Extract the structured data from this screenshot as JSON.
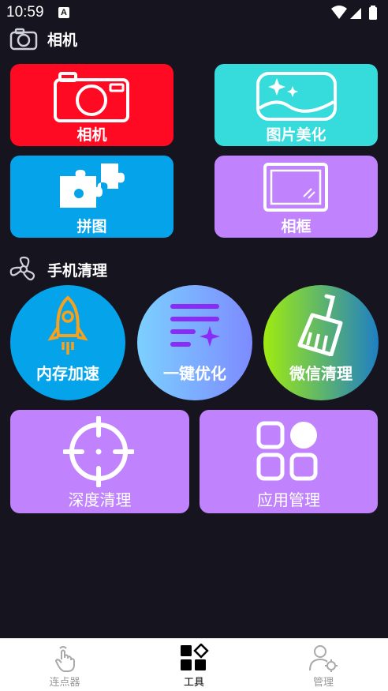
{
  "status": {
    "time": "10:59",
    "badge": "A"
  },
  "sections": {
    "camera": {
      "title": "相机"
    },
    "phone": {
      "title": "手机清理"
    }
  },
  "cards": {
    "camera": {
      "label": "相机",
      "color": "#ff0a22"
    },
    "beautify": {
      "label": "图片美化",
      "color": "#36dcdc"
    },
    "collage": {
      "label": "拼图",
      "color": "#05a3ea"
    },
    "frame": {
      "label": "相框",
      "color": "#c183fd"
    },
    "deep_clean": {
      "label": "深度清理",
      "color": "#c183fd"
    },
    "app_manage": {
      "label": "应用管理",
      "color": "#c183fd"
    }
  },
  "circles": {
    "memory": {
      "label": "内存加速"
    },
    "optimize": {
      "label": "一键优化"
    },
    "wechat": {
      "label": "微信清理"
    }
  },
  "nav": {
    "items": [
      {
        "label": "连点器",
        "icon": "tap-hand-icon",
        "active": false
      },
      {
        "label": "工具",
        "icon": "tools-grid-icon",
        "active": true
      },
      {
        "label": "管理",
        "icon": "user-gear-icon",
        "active": false
      }
    ]
  }
}
